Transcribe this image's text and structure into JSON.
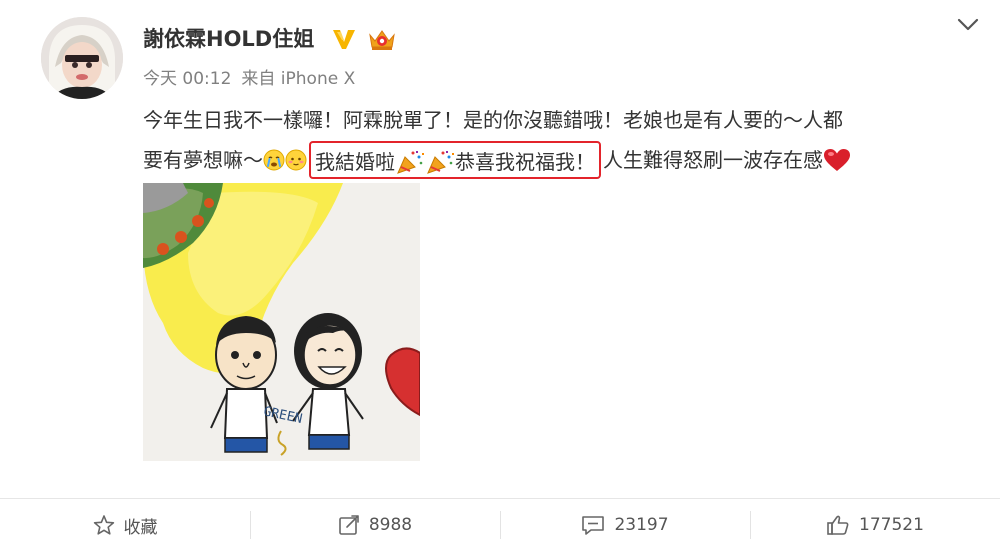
{
  "post": {
    "author": "謝依霖HOLD住姐",
    "time": "今天 00:12",
    "source": "来自 iPhone X",
    "text_line1": "今年生日我不一樣囉！阿霖脫單了！是的你沒聽錯哦！老娘也是有人要的～人都",
    "text_line2_a": "要有夢想嘛～",
    "text_highlight_a": "我結婚啦",
    "text_highlight_b": "恭喜我祝福我！",
    "text_line2_b": "人生難得怒刷一波存在感",
    "image_text": "GREEN"
  },
  "actions": {
    "favorite_label": "收藏",
    "repost_count": "8988",
    "comment_count": "23197",
    "like_count": "177521"
  },
  "colors": {
    "highlight_border": "#e3242b",
    "verified": "#f7b500",
    "heart": "#d91f2b"
  }
}
